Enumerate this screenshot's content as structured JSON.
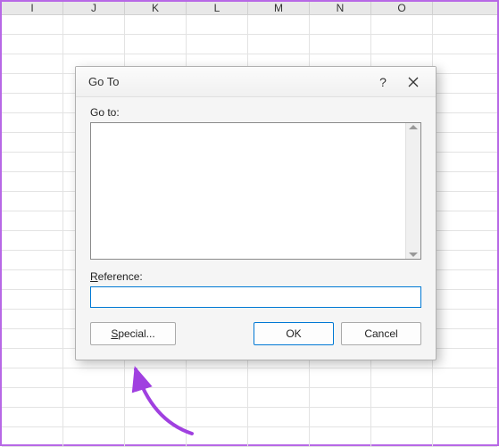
{
  "spreadsheet": {
    "columns": [
      "I",
      "J",
      "K",
      "L",
      "M",
      "N",
      "O"
    ]
  },
  "dialog": {
    "title": "Go To",
    "goto_label": "Go to:",
    "reference_label_prefix": "R",
    "reference_label_rest": "eference:",
    "reference_value": "",
    "buttons": {
      "special_prefix": "S",
      "special_rest": "pecial...",
      "ok": "OK",
      "cancel": "Cancel"
    },
    "help": "?"
  }
}
